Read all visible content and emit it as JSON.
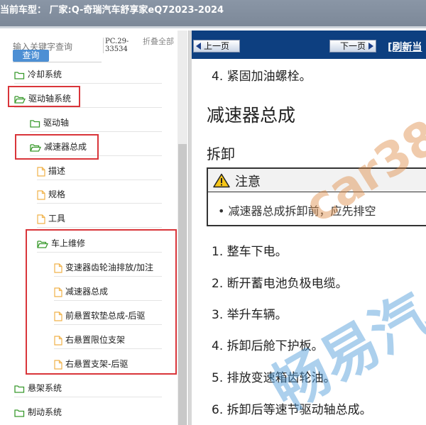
{
  "header": {
    "vehicle_label": "当前车型：  厂家:Q-奇瑞汽车舒享家eQ72023-2024"
  },
  "sidebar": {
    "search_placeholder": "输入关键字查询",
    "search_button": "查询",
    "pc_code": "PC.29-33534",
    "collapse_all": "折叠全部",
    "items": [
      {
        "label": "冷却系统",
        "icon": "folder-icon"
      },
      {
        "label": "驱动轴系统",
        "icon": "folder-open-icon"
      },
      {
        "label": "驱动轴",
        "icon": "folder-icon"
      },
      {
        "label": "减速器总成",
        "icon": "folder-open-icon"
      },
      {
        "label": "描述",
        "icon": "document-icon"
      },
      {
        "label": "规格",
        "icon": "document-icon"
      },
      {
        "label": "工具",
        "icon": "document-icon"
      },
      {
        "label": "车上维修",
        "icon": "folder-open-icon"
      },
      {
        "label": "变速器齿轮油排放/加注",
        "icon": "document-icon"
      },
      {
        "label": "减速器总成",
        "icon": "document-icon"
      },
      {
        "label": "前悬置软垫总成-后驱",
        "icon": "document-icon"
      },
      {
        "label": "右悬置限位支架",
        "icon": "document-icon"
      },
      {
        "label": "右悬置支架-后驱",
        "icon": "document-icon"
      },
      {
        "label": "悬架系统",
        "icon": "folder-icon"
      },
      {
        "label": "制动系统",
        "icon": "folder-icon"
      }
    ]
  },
  "toolbar": {
    "prev_label": "上一页",
    "next_label": "下一页",
    "refresh_label": "[刷新当"
  },
  "document": {
    "step_top": "4.  紧固加油螺栓。",
    "title": "减速器总成",
    "subtitle": "拆卸",
    "notice_title": "注意",
    "notice_text": "•  减速器总成拆卸前，应先排空",
    "steps": [
      "1.  整车下电。",
      "2.  断开蓄电池负极电缆。",
      "3.  举升车辆。",
      "4.  拆卸后舱下护板。",
      "5.  排放变速箱齿轮油。",
      "6.  拆卸后等速节驱动轴总成。"
    ]
  },
  "watermark": {
    "latin": "car38",
    "chinese": "畅易汽"
  },
  "colors": {
    "nav_blue": "#0d3f80",
    "highlight_red": "#d9353a",
    "folder_green": "#3a9a2e",
    "doc_orange": "#f0b24a"
  }
}
